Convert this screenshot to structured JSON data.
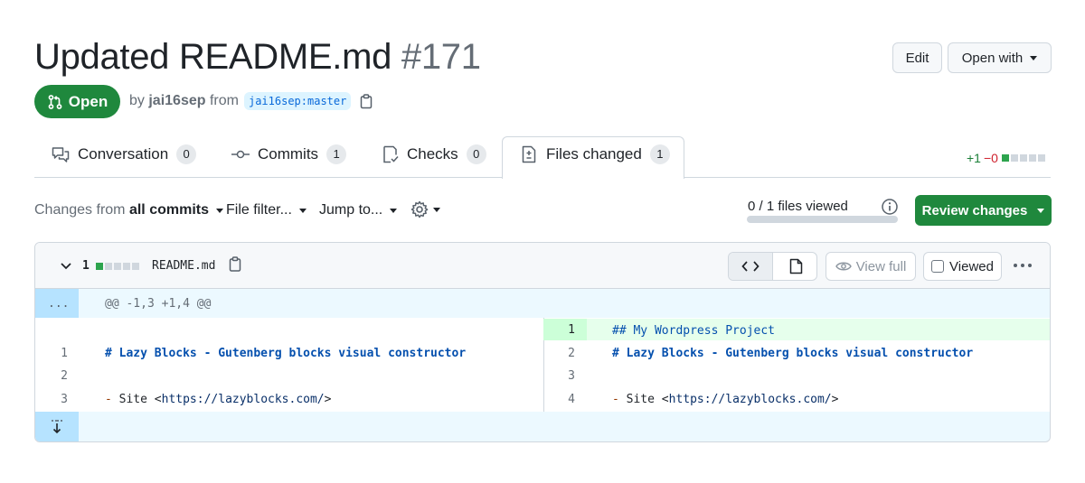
{
  "pr": {
    "title": "Updated README.md",
    "number": "#171",
    "state": "Open",
    "by_prefix": "by",
    "author": "jai16sep",
    "from_word": "from",
    "branch": "jai16sep:master"
  },
  "header_buttons": {
    "edit": "Edit",
    "open_with": "Open with"
  },
  "tabs": [
    {
      "label": "Conversation",
      "count": "0",
      "icon": "comment-discussion-icon"
    },
    {
      "label": "Commits",
      "count": "1",
      "icon": "git-commit-icon"
    },
    {
      "label": "Checks",
      "count": "0",
      "icon": "checklist-icon"
    },
    {
      "label": "Files changed",
      "count": "1",
      "icon": "file-diff-icon"
    }
  ],
  "diffstat": {
    "additions": "+1",
    "deletions": "−0"
  },
  "toolbar": {
    "changes_prefix": "Changes from",
    "changes_value": "all commits",
    "file_filter": "File filter...",
    "jump_to": "Jump to...",
    "files_viewed": "0 / 1 files viewed",
    "review_changes": "Review changes"
  },
  "file": {
    "count": "1",
    "name": "README.md",
    "view_full": "View full",
    "viewed": "Viewed",
    "hunk_expand": "...",
    "hunk_header": "@@ -1,3 +1,4 @@",
    "left_lines": [
      {
        "num": "1",
        "text": "# Lazy Blocks - Gutenberg blocks visual constructor"
      },
      {
        "num": "2",
        "text": ""
      },
      {
        "num": "3",
        "text": "- Site <https://lazyblocks.com/>"
      }
    ],
    "right_lines": [
      {
        "num": "1",
        "text": "## My Wordpress Project",
        "added": true
      },
      {
        "num": "2",
        "text": "# Lazy Blocks - Gutenberg blocks visual constructor"
      },
      {
        "num": "3",
        "text": ""
      },
      {
        "num": "4",
        "text": "- Site <https://lazyblocks.com/>"
      }
    ]
  },
  "colors": {
    "open_green": "#1f883d",
    "addition_bg": "#e6ffec",
    "addition_gutter": "#ccffd8",
    "hunk_bg": "#ddf4ff",
    "link_blue": "#0969da"
  }
}
